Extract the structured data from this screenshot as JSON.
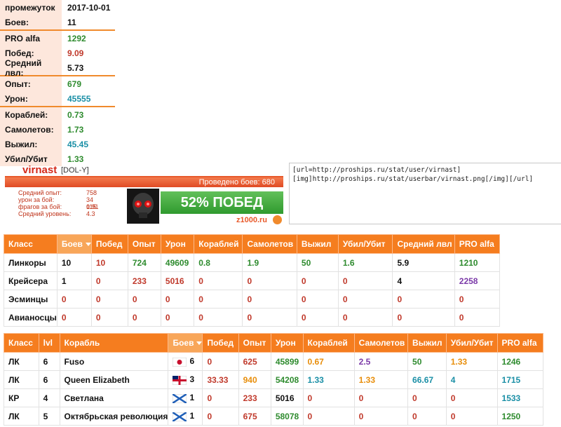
{
  "stats": [
    {
      "label": "промежуток",
      "value": "2017-10-01"
    },
    {
      "label": "Боев:",
      "value": "11"
    },
    {
      "label": "PRO alfa",
      "value": "1292"
    },
    {
      "label": "Побед:",
      "value": "9.09"
    },
    {
      "label": "Средний лвл:",
      "value": "5.73"
    },
    {
      "label": "Опыт:",
      "value": "679"
    },
    {
      "label": "Урон:",
      "value": "45555"
    },
    {
      "label": "Кораблей:",
      "value": "0.73"
    },
    {
      "label": "Самолетов:",
      "value": "1.73"
    },
    {
      "label": "Выжил:",
      "value": "45.45"
    },
    {
      "label": "Убил/Убит",
      "value": "1.33"
    }
  ],
  "userbar": {
    "name": "virnast",
    "clan": "[DOL-Y]",
    "battles": "Проведено боев: 680",
    "wins": "52% ПОБЕД",
    "site": "z1000.ru",
    "rows": [
      {
        "key": "Средний опыт:",
        "value": "758"
      },
      {
        "key": "урон за бой:",
        "value": "34 115"
      },
      {
        "key": "фрагов за бой:",
        "value": "0.91"
      },
      {
        "key": "Средний уровень:",
        "value": "4.3"
      }
    ]
  },
  "code": {
    "line1": "[url=http://proships.ru/stat/user/virnast]",
    "line2": "[img]http://proships.ru/stat/userbar/virnast.png[/img][/url]"
  },
  "class_table": {
    "headers": [
      "Класс",
      "Боев",
      "Побед",
      "Опыт",
      "Урон",
      "Кораблей",
      "Самолетов",
      "Выжил",
      "Убил/Убит",
      "Средний лвл",
      "PRO alfa"
    ],
    "rows": [
      [
        "Линкоры",
        "10",
        "10",
        "724",
        "49609",
        "0.8",
        "1.9",
        "50",
        "1.6",
        "5.9",
        "1210"
      ],
      [
        "Крейсера",
        "1",
        "0",
        "233",
        "5016",
        "0",
        "0",
        "0",
        "0",
        "4",
        "2258"
      ],
      [
        "Эсминцы",
        "0",
        "0",
        "0",
        "0",
        "0",
        "0",
        "0",
        "0",
        "0",
        "0"
      ],
      [
        "Авианосцы",
        "0",
        "0",
        "0",
        "0",
        "0",
        "0",
        "0",
        "0",
        "0",
        "0"
      ]
    ]
  },
  "ship_table": {
    "headers": [
      "Класс",
      "lvl",
      "Корабль",
      "Боев",
      "Побед",
      "Опыт",
      "Урон",
      "Кораблей",
      "Самолетов",
      "Выжил",
      "Убил/Убит",
      "PRO alfa"
    ],
    "rows": [
      {
        "cls": "ЛК",
        "lvl": "6",
        "ship": "Fuso",
        "flag": "japan",
        "battles": "6",
        "wins": "0",
        "exp": "625",
        "dmg": "45899",
        "ships": "0.67",
        "planes": "2.5",
        "surv": "50",
        "kd": "1.33",
        "pro": "1246"
      },
      {
        "cls": "ЛК",
        "lvl": "6",
        "ship": "Queen Elizabeth",
        "flag": "uk",
        "battles": "3",
        "wins": "33.33",
        "exp": "940",
        "dmg": "54208",
        "ships": "1.33",
        "planes": "1.33",
        "surv": "66.67",
        "kd": "4",
        "pro": "1715"
      },
      {
        "cls": "КР",
        "lvl": "4",
        "ship": "Светлана",
        "flag": "ussr",
        "battles": "1",
        "wins": "0",
        "exp": "233",
        "dmg": "5016",
        "ships": "0",
        "planes": "0",
        "surv": "0",
        "kd": "0",
        "pro": "1533"
      },
      {
        "cls": "ЛК",
        "lvl": "5",
        "ship": "Октябрьская революция",
        "flag": "ussr",
        "battles": "1",
        "wins": "0",
        "exp": "675",
        "dmg": "58078",
        "ships": "0",
        "planes": "0",
        "surv": "0",
        "kd": "0",
        "pro": "1250"
      }
    ]
  }
}
